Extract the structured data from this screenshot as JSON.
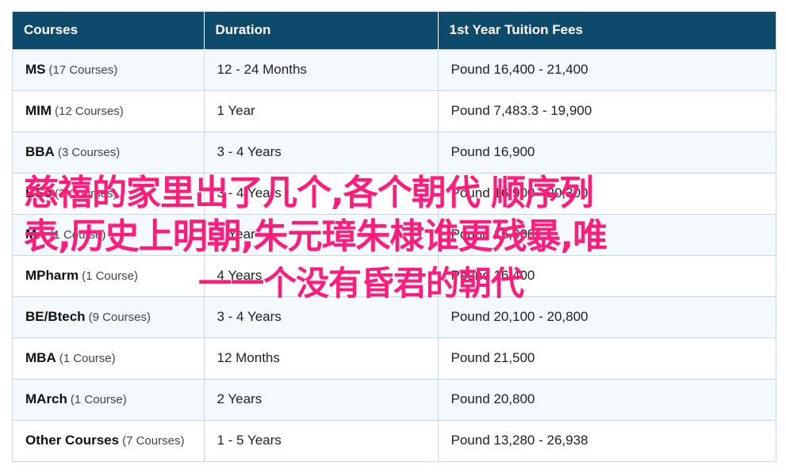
{
  "table": {
    "headers": [
      "Courses",
      "Duration",
      "1st Year Tuition Fees"
    ],
    "rows": [
      {
        "name": "MS",
        "count": "(17 Courses)",
        "duration": "12 - 24 Months",
        "fees": "Pound 16,400 - 21,400"
      },
      {
        "name": "MIM",
        "count": "(12 Courses)",
        "duration": "1 Year",
        "fees": "Pound 7,483.3 - 19,900"
      },
      {
        "name": "BBA",
        "count": "(3 Courses)",
        "duration": "3 - 4 Years",
        "fees": "Pound 16,900"
      },
      {
        "name": "BSc",
        "count": "(3 Courses)",
        "duration": "3 - 4 Years",
        "fees": "Pound 16,900 - 20,300"
      },
      {
        "name": "MA",
        "count": "(1 Course)",
        "duration": "1 Year",
        "fees": "Pound 16,900"
      },
      {
        "name": "MPharm",
        "count": "(1 Course)",
        "duration": "4 Years",
        "fees": "Pound 16,400"
      },
      {
        "name": "BE/Btech",
        "count": "(9 Courses)",
        "duration": "3 - 4 Years",
        "fees": "Pound 20,100 - 20,800"
      },
      {
        "name": "MBA",
        "count": "(1 Course)",
        "duration": "12 Months",
        "fees": "Pound 21,500"
      },
      {
        "name": "MArch",
        "count": "(1 Course)",
        "duration": "2 Years",
        "fees": "Pound 20,800"
      },
      {
        "name": "Other Courses",
        "count": "(7 Courses)",
        "duration": "1 - 5 Years",
        "fees": "Pound 13,280 - 26,938"
      }
    ]
  },
  "overlay": {
    "line1": "慈禧的家里出了几个,各个朝代 顺序列",
    "line2": "表,历史上明朝,朱元璋朱棣谁更残暴,唯",
    "line3": "一一个没有昏君的朝代",
    "color": "#ff1c7b"
  },
  "colors": {
    "header_bg": "#0d4a6b",
    "row_alt_bg": "#f3f9fd",
    "border": "#c9d7e0"
  }
}
